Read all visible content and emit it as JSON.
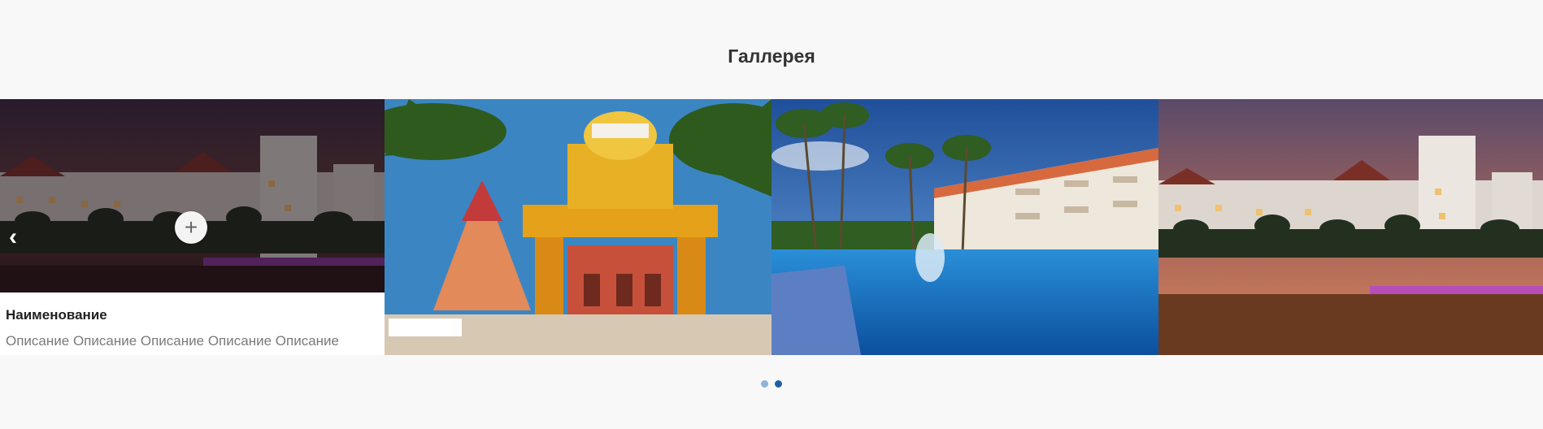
{
  "section": {
    "title": "Галлерея"
  },
  "active_card": {
    "name": "Наименование",
    "description": "Описание Описание Описание Описание Описание",
    "zoom_label": "+"
  },
  "nav": {
    "prev_glyph": "‹"
  },
  "pager": {
    "dots": [
      {
        "state": "inactive",
        "color": "#8fb3d6"
      },
      {
        "state": "active",
        "color": "#1f5fa8"
      }
    ]
  },
  "colors": {
    "page_bg": "#f8f8f8",
    "title": "#333333",
    "description": "#7a7a7a"
  }
}
